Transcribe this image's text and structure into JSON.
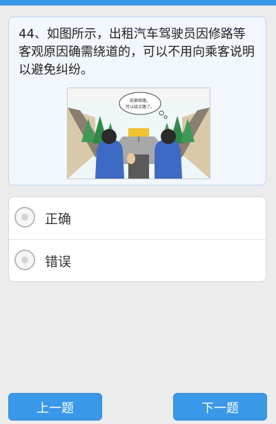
{
  "question": {
    "text": "44、如图所示，出租汽车驾驶员因修路等客观原因确需绕道的，可以不用向乘客说明以避免纠纷。",
    "image_alt": "taxi-interior-illustration",
    "speech_bubble": {
      "line1": "前面修路，",
      "line2": "可以绕点路了。"
    }
  },
  "options": [
    {
      "label": "正确"
    },
    {
      "label": "错误"
    }
  ],
  "nav": {
    "prev_label": "上一题",
    "next_label": "下一题"
  },
  "colors": {
    "accent": "#3a98e8",
    "card_bg": "#f2f7fe",
    "card_border": "#b9d5f5"
  }
}
